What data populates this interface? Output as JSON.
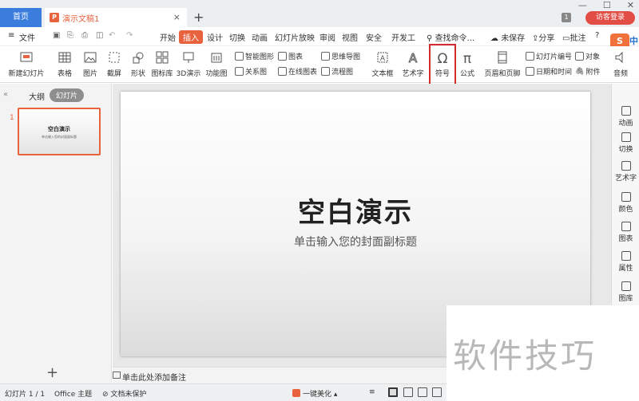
{
  "titlebar": {
    "home_tab": "首页",
    "doc_icon": "P",
    "doc_tab": "演示文稿1",
    "close_glyph": "×",
    "add_tab_glyph": "+",
    "badge": "1",
    "login": "访客登录",
    "minimize_glyph": "—",
    "maximize_glyph": "☐",
    "close_window_glyph": "✕"
  },
  "menubar": {
    "hamburger": "≡",
    "file": "文件",
    "items": [
      "开始",
      "插入",
      "设计",
      "切换",
      "动画",
      "幻灯片放映",
      "审阅",
      "视图",
      "安全",
      "开发工"
    ],
    "active": "插入",
    "find": "查找命令...",
    "unsaved": "未保存",
    "share": "分享",
    "comment": "批注",
    "help": "?",
    "ime": "S",
    "ime_lang": "中"
  },
  "ribbon": {
    "new_slide": "新建幻灯片",
    "table": "表格",
    "picture": "图片",
    "screenshot": "截屏",
    "shape": "形状",
    "icon_lib": "图标库",
    "demo3d": "3D演示",
    "function_chart": "功能图",
    "smart_shape": "智能图形",
    "chart": "图表",
    "relation_chart": "关系图",
    "online_chart": "在线图表",
    "mind_map": "思维导图",
    "flowchart": "流程图",
    "textbox": "文本框",
    "wordart": "艺术字",
    "symbol": "符号",
    "formula": "公式",
    "header_footer": "页眉和页脚",
    "slide_number": "幻灯片编号",
    "date_time": "日期和时间",
    "object": "对象",
    "attachment": "附件",
    "audio": "音频"
  },
  "left_panel": {
    "collapse": "«",
    "outline_tab": "大纲",
    "slides_tab": "幻灯片",
    "thumb_number": "1",
    "thumb_title": "空白演示",
    "thumb_subtitle": "单击输入您的封面副标题",
    "add_slide": "+"
  },
  "slide": {
    "title": "空白演示",
    "subtitle": "单击输入您的封面副标题"
  },
  "notes": "单击此处添加备注",
  "right_pane": [
    "动画",
    "切换",
    "艺术字",
    "颜色",
    "图表",
    "属性",
    "图库"
  ],
  "status": {
    "slide_count": "幻灯片 1 / 1",
    "theme": "Office 主题",
    "protection": "文档未保护",
    "beautify": "一键美化",
    "notes_toggle": "≡"
  },
  "watermark": "软件技巧",
  "colors": {
    "accent": "#e8623d",
    "home_tab": "#3b7ddd",
    "login": "#e24d45",
    "highlight_box": "#d72a2a"
  }
}
